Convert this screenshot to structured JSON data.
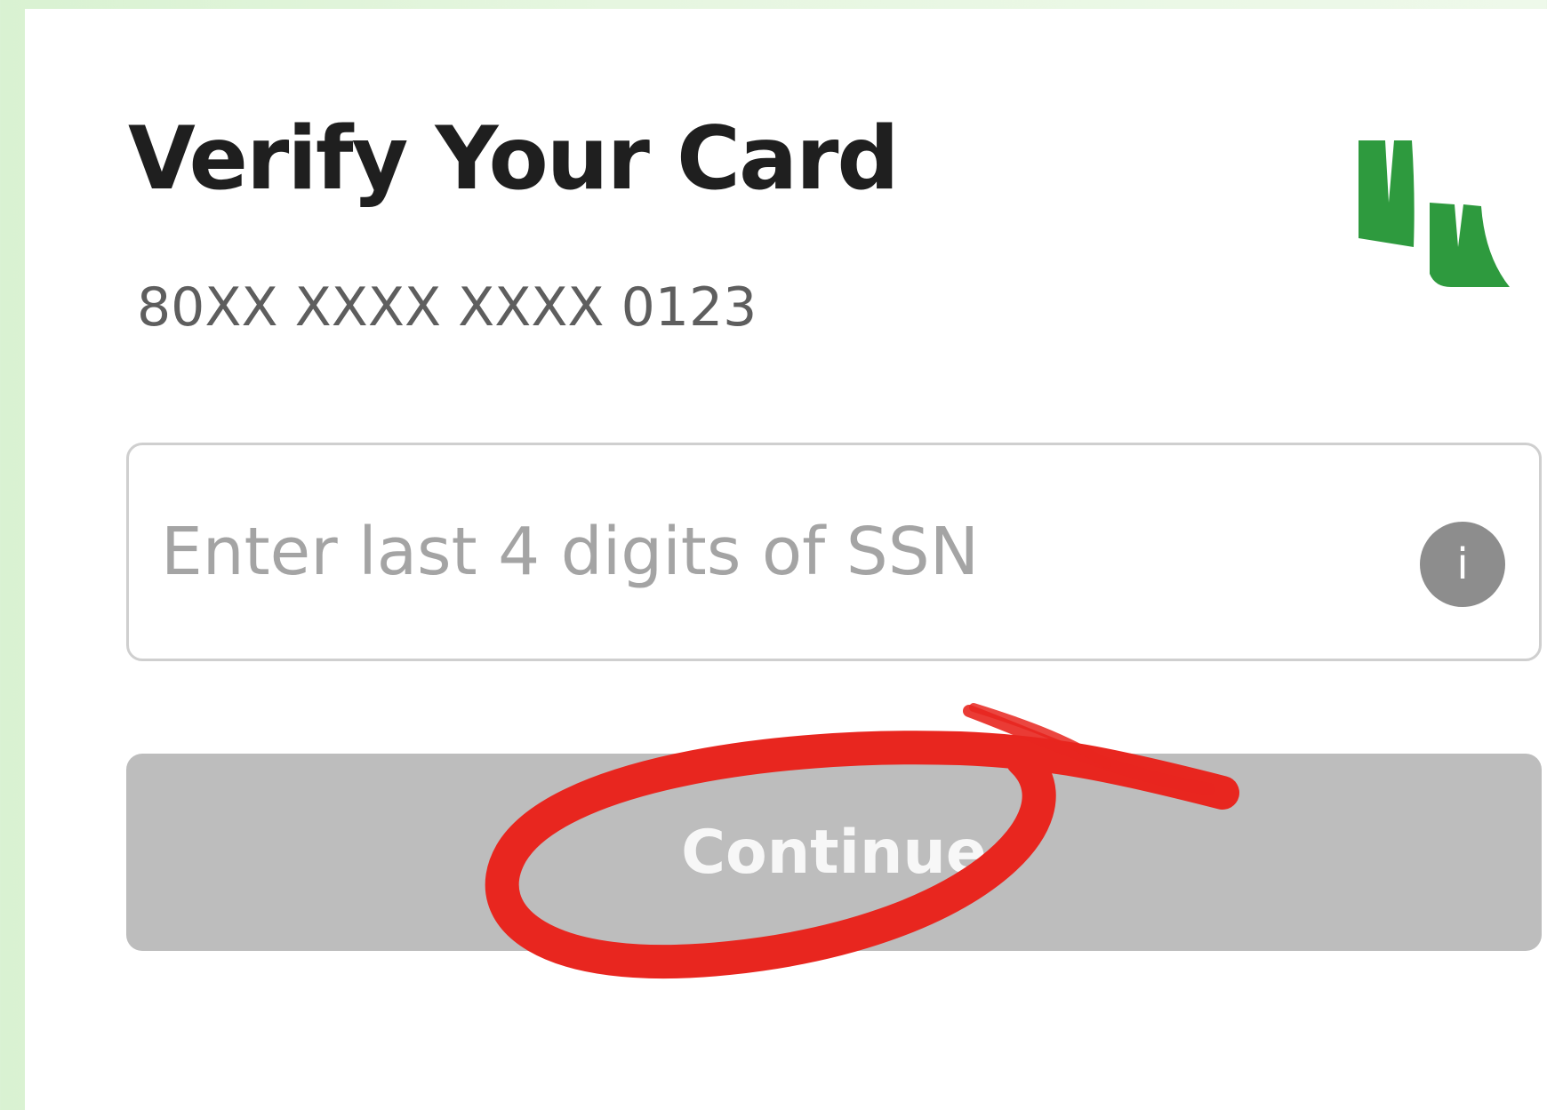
{
  "verify_form": {
    "title": "Verify Your Card",
    "card_number_masked": "80XX XXXX XXXX 0123",
    "ssn_field": {
      "placeholder": "Enter last 4 digits of SSN",
      "value": ""
    },
    "info_icon": {
      "glyph": "i",
      "icon_name": "info-icon"
    },
    "continue_label": "Continue"
  },
  "colors": {
    "background": "#e2f4dc",
    "title": "#1f1f1f",
    "card_number": "#5e5e5e",
    "placeholder": "#a4a4a4",
    "button_disabled": "#bdbdbd",
    "button_text": "#f7f7f7",
    "brand_logo": "#2e9a3e",
    "annotation_circle": "#e8261f"
  }
}
